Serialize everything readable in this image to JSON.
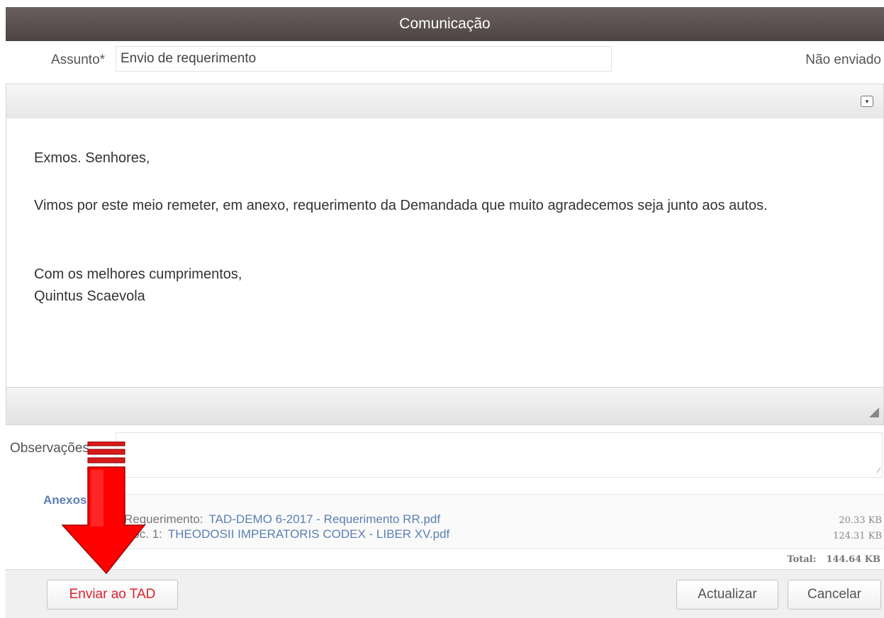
{
  "dialog": {
    "title": "Comunicação"
  },
  "form": {
    "subject_label": "Assunto*",
    "subject_value": "Envio de requerimento",
    "status": "Não enviado",
    "observations_label": "Observações"
  },
  "message": {
    "greeting": "Exmos. Senhores,",
    "body": "Vimos por este meio remeter, em anexo, requerimento da Demandada que muito agradecemos seja junto aos autos.",
    "closing": "Com os melhores cumprimentos,",
    "signature": "Quintus Scaevola"
  },
  "attachments": {
    "label": "Anexos",
    "items": [
      {
        "kind": "Requerimento:",
        "file": "TAD-DEMO 6-2017 - Requerimento RR.pdf",
        "size": "20.33 KB"
      },
      {
        "kind": "Doc. 1:",
        "file": "THEODOSII IMPERATORIS CODEX - LIBER XV.pdf",
        "size": "124.31 KB"
      }
    ],
    "total_label": "Total:",
    "total_value": "144.64 KB"
  },
  "buttons": {
    "send": "Enviar ao TAD",
    "update": "Actualizar",
    "cancel": "Cancelar"
  },
  "icons": {
    "toolbar_toggle": "chevron-down-icon",
    "resize": "resize-grip-icon",
    "annotation": "red-arrow-down"
  },
  "colors": {
    "titlebar": "#5a5050",
    "send_button_text": "#e0202a",
    "link": "#5a7fb3",
    "annotation_arrow": "#ff0000"
  }
}
